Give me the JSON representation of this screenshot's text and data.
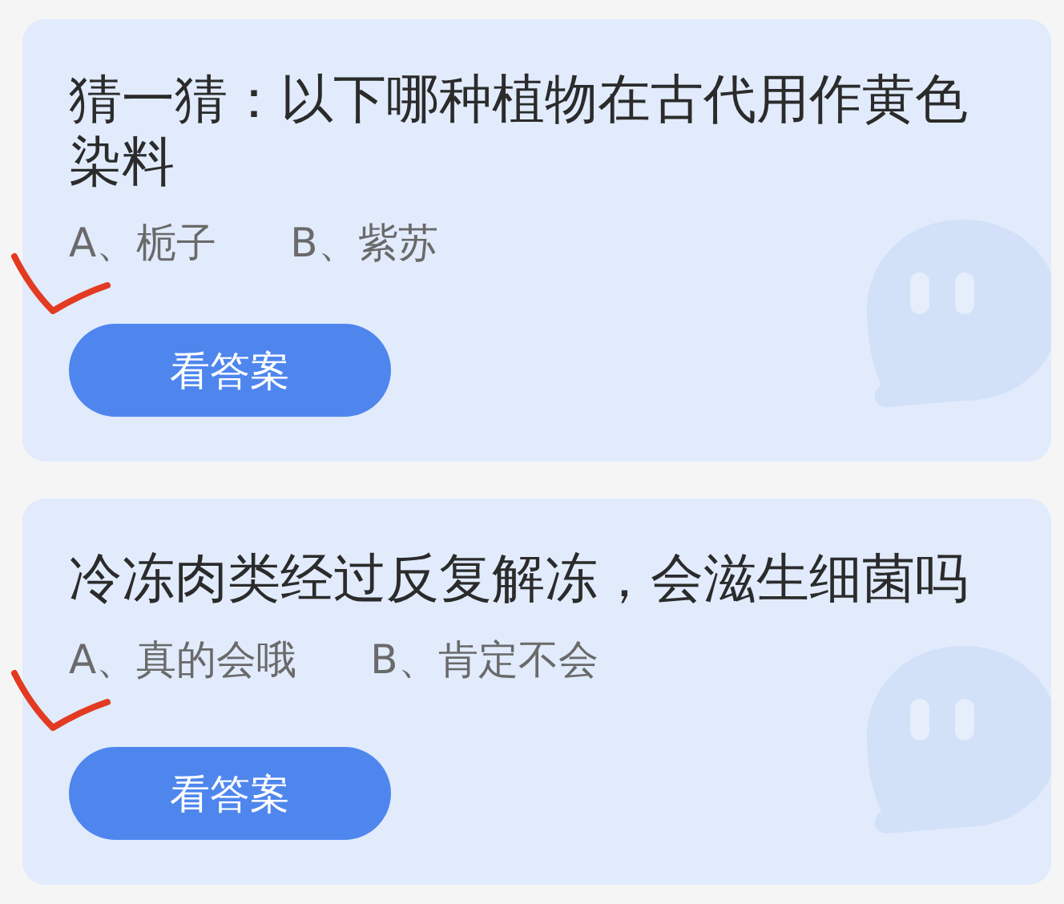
{
  "cards": [
    {
      "question": "猜一猜：以下哪种植物在古代用作黄色染料",
      "options": [
        {
          "text": "A、栀子",
          "marked": true
        },
        {
          "text": "B、紫苏",
          "marked": false
        }
      ],
      "button": "看答案"
    },
    {
      "question": "冷冻肉类经过反复解冻，会滋生细菌吗",
      "options": [
        {
          "text": "A、真的会哦",
          "marked": true
        },
        {
          "text": "B、肯定不会",
          "marked": false
        }
      ],
      "button": "看答案"
    }
  ]
}
